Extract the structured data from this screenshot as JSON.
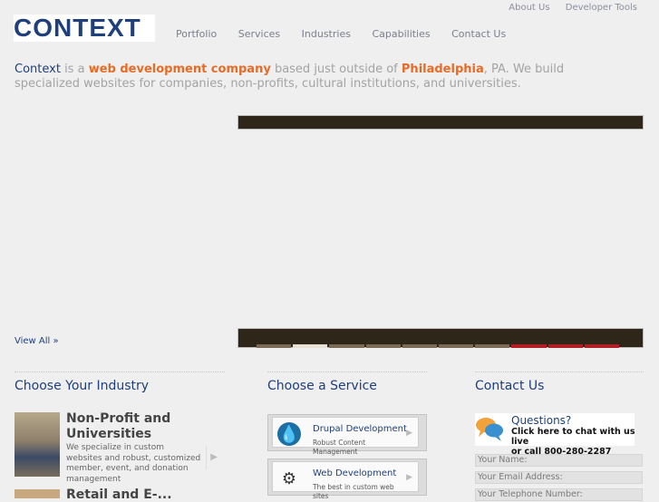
{
  "brand": {
    "logo_text": "CONTEXT"
  },
  "utility_nav": [
    {
      "label": "About Us"
    },
    {
      "label": "Developer Tools"
    }
  ],
  "main_nav": [
    {
      "label": "Portfolio"
    },
    {
      "label": "Services"
    },
    {
      "label": "Industries"
    },
    {
      "label": "Capabilities"
    },
    {
      "label": "Contact Us"
    }
  ],
  "intro": {
    "brand": "Context",
    "t1": " is a ",
    "highlight1": "web development company",
    "t2": " based just outside of ",
    "highlight2": "Philadelphia",
    "t3": ", PA. We build specialized websites for companies, non-profits, cultural institutions, and universities."
  },
  "view_all": "View All »",
  "sections": {
    "industry_title": "Choose Your Industry",
    "service_title": "Choose a Service",
    "contact_title": "Contact Us"
  },
  "industry": {
    "title": "Non-Profit and Universities",
    "description": "We specialize in custom websites and robust, customized member, event, and donation management",
    "next_title": "Retail and E-..."
  },
  "services": [
    {
      "title": "Drupal Development",
      "subtitle": "Robust Content Management"
    },
    {
      "title": "Web Development",
      "subtitle": "The best in custom web sites"
    }
  ],
  "contact": {
    "chat_title": "Questions?",
    "chat_line1": "Click here to chat with us live",
    "chat_line2": "or call 800-280-2287",
    "fields": [
      {
        "placeholder": "Your Name:"
      },
      {
        "placeholder": "Your Email Address:"
      },
      {
        "placeholder": "Your Telephone Number:"
      }
    ]
  },
  "colors": {
    "brand": "#1f3f7a",
    "accent": "#e86b25",
    "background": "#efefef"
  }
}
